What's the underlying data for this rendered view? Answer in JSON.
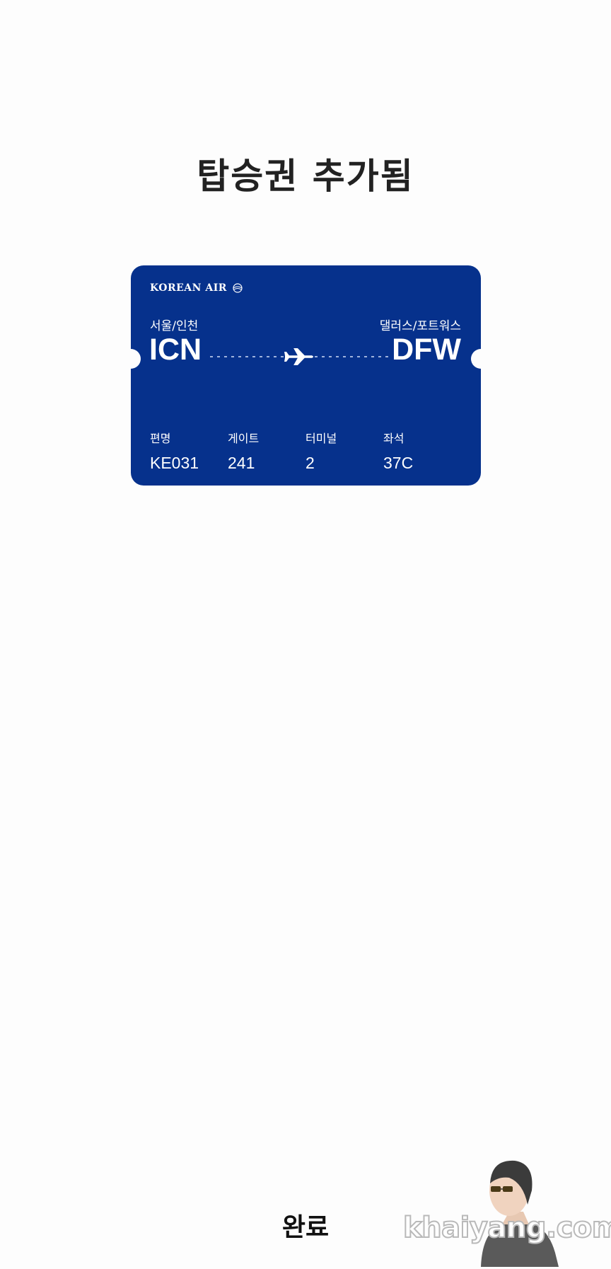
{
  "page": {
    "title": "탑승권 추가됨"
  },
  "ticket": {
    "airline_logo": "KOREAN AIR",
    "background_color": "#06318c",
    "origin": {
      "city": "서울/인천",
      "code": "ICN"
    },
    "destination": {
      "city": "댈러스/포트워스",
      "code": "DFW"
    },
    "route_icon": "airplane-icon",
    "details": [
      {
        "label": "편명",
        "value": "KE031"
      },
      {
        "label": "게이트",
        "value": "241"
      },
      {
        "label": "터미널",
        "value": "2"
      },
      {
        "label": "좌석",
        "value": "37C"
      }
    ]
  },
  "footer": {
    "done_label": "완료"
  },
  "watermark": {
    "text": "khaiyang.com"
  }
}
